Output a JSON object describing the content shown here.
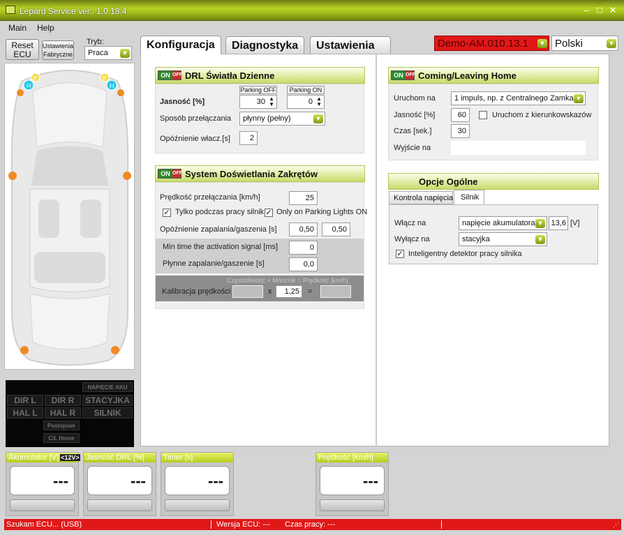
{
  "window": {
    "title": "Lepard Service  ver.: 1.0.18.4"
  },
  "menu": {
    "main": "Main",
    "help": "Help"
  },
  "sidebar": {
    "reset_label": "Reset ECU",
    "factory_label": "Ustawienia Fabryczne",
    "mode_label": "Tryb:",
    "mode_value": "Praca"
  },
  "tabs": {
    "config": "Konfiguracja",
    "diag": "Diagnostyka",
    "settings": "Ustawienia"
  },
  "device": {
    "name": "Demo-AM.010.13.1",
    "language": "Polski"
  },
  "toggle": {
    "on": "ON",
    "off": "OFF"
  },
  "drl": {
    "title": "DRL Światła Dzienne",
    "brightness_label": "Jasność [%]",
    "parking_off_label": "Parking OFF",
    "parking_on_label": "Parking ON",
    "parking_off_value": "30",
    "parking_on_value": "0",
    "switch_label": "Sposób przełączania",
    "switch_value": "płynny (pełny)",
    "delay_label": "Opóźnienie włacz.[s]",
    "delay_value": "2"
  },
  "cornering": {
    "title": "System Doświetlania Zakrętów",
    "speed_label": "Prędkość przełączania [km/h]",
    "speed_value": "25",
    "engine_only_label": "Tylko podczas pracy silnik",
    "parking_only_label": "Only on Parking Lights ON",
    "delay_label": "Opóźnienie zapalania/gaszenia [s]",
    "delay_on": "0,50",
    "delay_off": "0,50",
    "min_time_label": "Min time the activation signal [ms]",
    "min_time_value": "0",
    "smooth_label": "Płynne zapalanie/gaszenie  [s]",
    "smooth_value": "0,0",
    "cal_freq_label": "Częstotliwość",
    "cal_x": "x",
    "cal_mult_label": "Mnożnik",
    "cal_eq": "=",
    "cal_speed_label": "Prędkość [km/h]",
    "cal_label": "Kalibracja prędkości",
    "cal_mult_value": "1,25"
  },
  "coming": {
    "title": "Coming/Leaving Home",
    "trigger_label": "Uruchom na",
    "trigger_value": "1 impuls, np. z Centralnego Zamka",
    "brightness_label": "Jasność [%]",
    "brightness_value": "60",
    "blinker_label": "Uruchom z kierunkowskazów",
    "time_label": "Czas [sek.]",
    "time_value": "30",
    "output_label": "Wyjście na",
    "output_value": ""
  },
  "general": {
    "title": "Opcje Ogólne",
    "tab_voltage": "Kontrola napięcia",
    "tab_engine": "Silnik",
    "on_label": "Włącz na",
    "on_value": "napięcie akumulatora",
    "voltage_value": "13,6",
    "voltage_unit": "[V]",
    "off_label": "Wyłącz na",
    "off_value": "stacyjka",
    "detector_label": "Inteligentny detektor pracy silnika"
  },
  "indicators": {
    "dir_l": "DIR L",
    "dir_r": "DIR R",
    "stacyjka": "STACYJKA",
    "hal_l": "HAL L",
    "hal_r": "HAL R",
    "silnik": "SILNIK",
    "napiecie": "NAPIĘCIE AKU",
    "postojowe": "Postojowe",
    "cl_home": "C/L Home"
  },
  "gauges": [
    {
      "label": "Akumulator [V]",
      "badge": "<12V>",
      "value": "---"
    },
    {
      "label": "Jasność DRL [%]",
      "value": "---"
    },
    {
      "label": "Timer [s]",
      "value": "---"
    },
    {
      "label": "Prędkość [km/h]",
      "value": "---"
    }
  ],
  "car": {
    "h_letter": "H",
    "p_letter": "P"
  },
  "status": {
    "search": "Szukam ECU... (USB)",
    "ecu_version": "Wersja ECU: ---",
    "runtime": "Czas pracy: ---"
  }
}
